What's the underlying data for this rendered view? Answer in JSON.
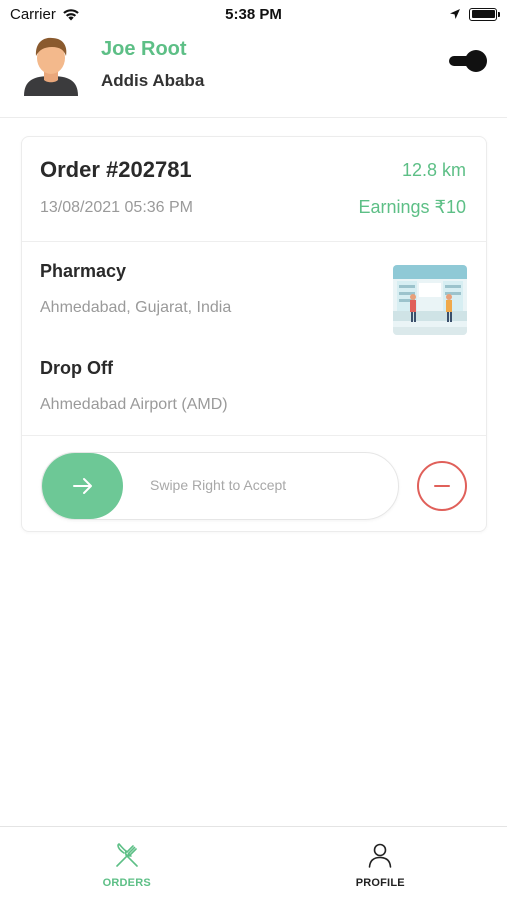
{
  "status_bar": {
    "carrier": "Carrier",
    "time": "5:38 PM"
  },
  "header": {
    "user_name": "Joe Root",
    "city": "Addis Ababa"
  },
  "order": {
    "number": "Order #202781",
    "distance": "12.8 km",
    "date": "13/08/2021 05:36 PM",
    "earnings": "Earnings ₹10",
    "pickup_title": "Pharmacy",
    "pickup_address": "Ahmedabad, Gujarat, India",
    "drop_title": "Drop Off",
    "drop_address": "Ahmedabad Airport (AMD)",
    "swipe_label": "Swipe Right to Accept"
  },
  "tabs": [
    {
      "label": "ORDERS",
      "icon": "fork-knife-icon",
      "active": true
    },
    {
      "label": "PROFILE",
      "icon": "person-icon",
      "active": false
    }
  ],
  "colors": {
    "accent": "#5dbf86",
    "reject": "#e0605a",
    "muted": "#9a9a9a"
  }
}
